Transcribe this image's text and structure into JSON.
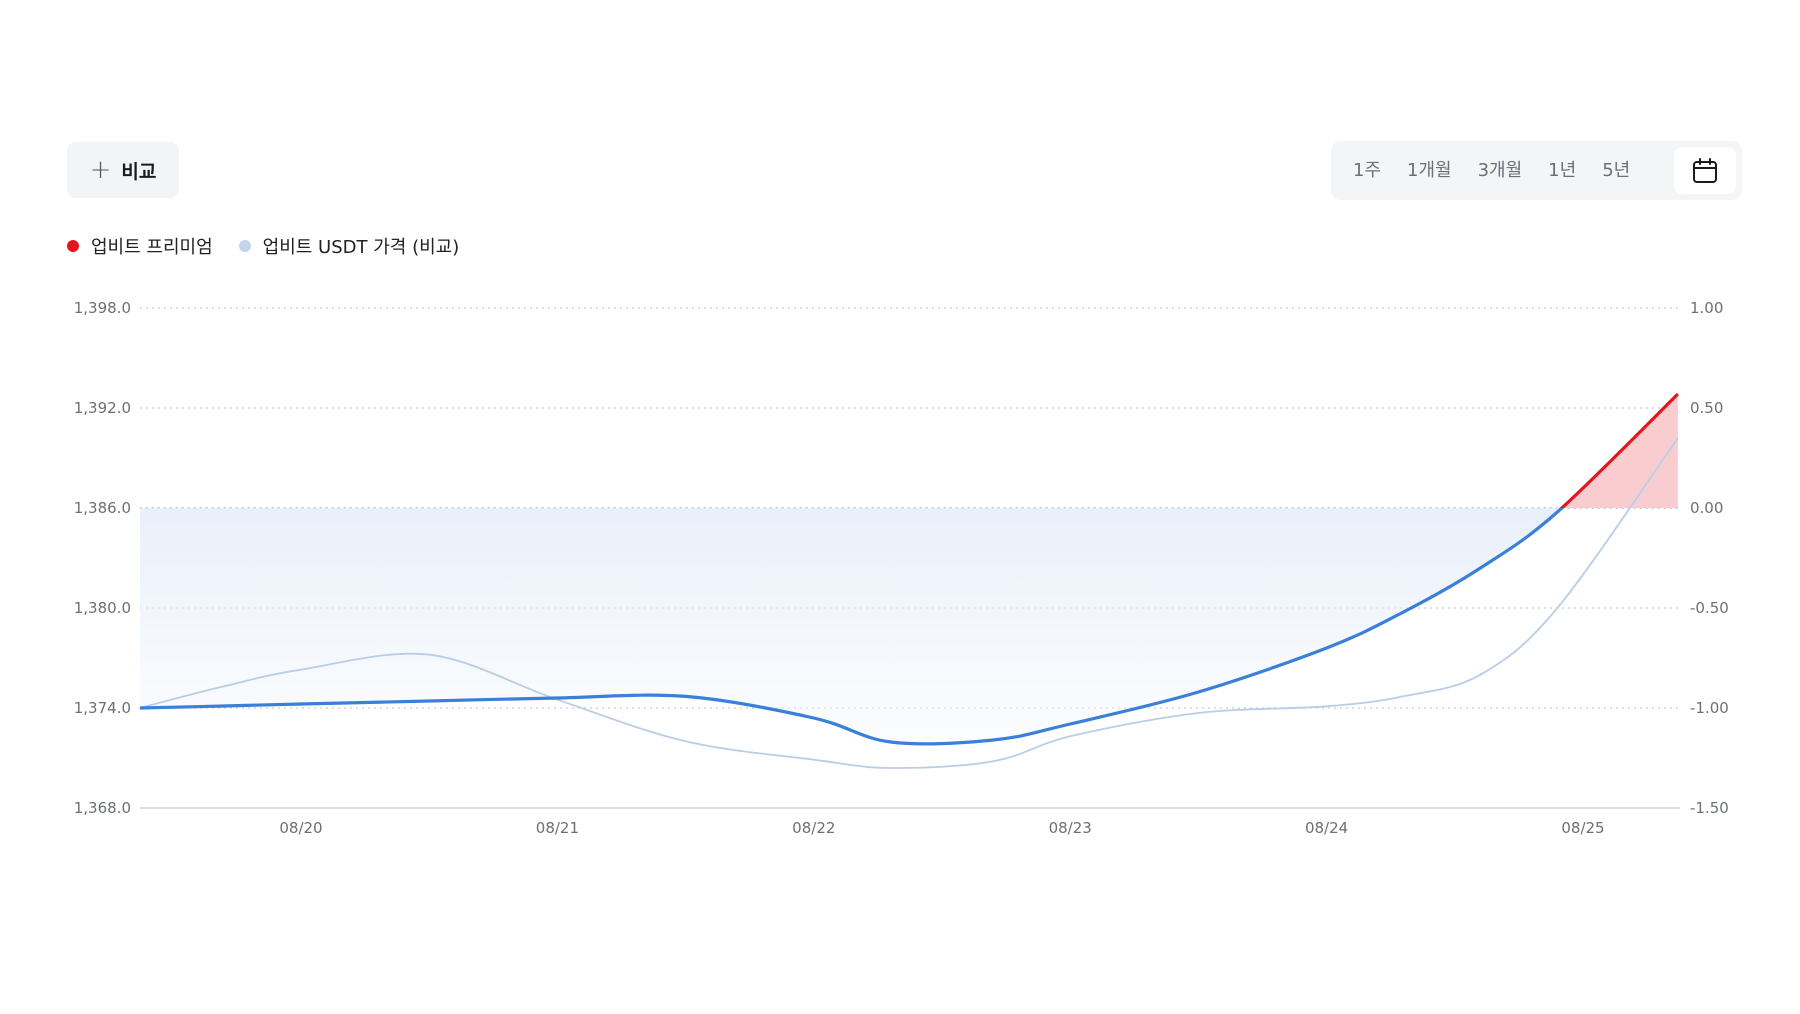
{
  "compare_button": {
    "label": "비교"
  },
  "range_options": [
    "1주",
    "1개월",
    "3개월",
    "1년",
    "5년"
  ],
  "colors": {
    "premium_positive": "#e5141f",
    "premium_negative": "#3a7fd9",
    "comparison_line": "#b9cde6",
    "negative_fill": "#dbe7f7",
    "positive_fill": "#f8c8cb",
    "legend_premium": "#e5141f",
    "legend_usdt": "#c3d4ea"
  },
  "chart_data": {
    "type": "line",
    "legend": [
      {
        "name": "업비트 프리미엄",
        "color": "#e5141f"
      },
      {
        "name": "업비트 USDT 가격 (비교)",
        "color": "#c3d4ea"
      }
    ],
    "x_labels": [
      "08/20",
      "08/21",
      "08/22",
      "08/23",
      "08/24",
      "08/25"
    ],
    "y_left": {
      "ticks": [
        "1,398.0",
        "1,392.0",
        "1,386.0",
        "1,380.0",
        "1,374.0",
        "1,368.0"
      ],
      "range": [
        1368,
        1398
      ]
    },
    "y_right": {
      "ticks": [
        "1.00",
        "0.50",
        "0.00",
        "-0.50",
        "-1.00",
        "-1.50"
      ],
      "range": [
        -1.5,
        1.0
      ]
    },
    "x": [
      -0.63,
      -0.3,
      0,
      0.5,
      1,
      1.5,
      2,
      2.3,
      2.7,
      3,
      3.5,
      4,
      4.3,
      4.6,
      4.9,
      5.37
    ],
    "series": [
      {
        "name": "업비트 프리미엄",
        "axis": "right",
        "values": [
          -1.0,
          -0.99,
          -0.98,
          -0.965,
          -0.95,
          -0.942,
          -1.05,
          -1.17,
          -1.16,
          -1.08,
          -0.92,
          -0.7,
          -0.52,
          -0.3,
          -0.02,
          0.57
        ]
      },
      {
        "name": "업비트 USDT 가격 (비교)",
        "axis": "left",
        "values": [
          1374.0,
          1375.3,
          1376.3,
          1377.2,
          1374.5,
          1372.0,
          1370.9,
          1370.4,
          1370.8,
          1372.3,
          1373.7,
          1374.1,
          1374.7,
          1376.0,
          1380.0,
          1390.2
        ]
      }
    ],
    "grid": "horizontal-dotted",
    "baseline": 0.0
  }
}
